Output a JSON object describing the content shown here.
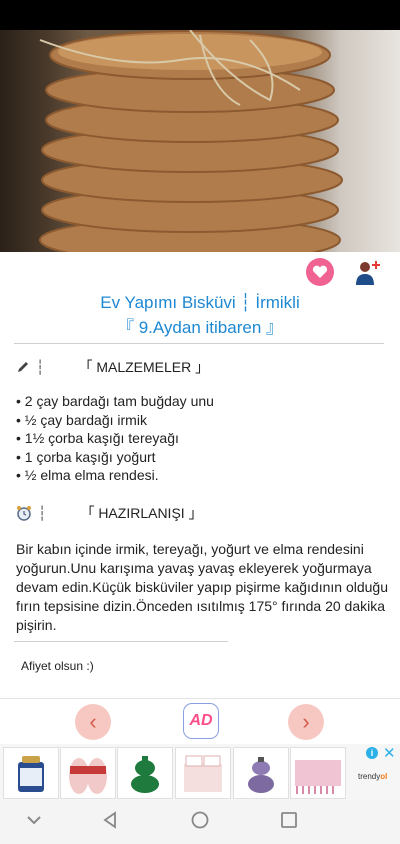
{
  "recipe": {
    "title_line1": "Ev Yapımı Bisküvi ┆ İrmikli",
    "title_line2": "『 9.Aydan itibaren 』"
  },
  "ingredients_section": {
    "icon": "pencil-icon",
    "separator": "┆",
    "label": "「 MALZEMELER 」",
    "items": [
      "• 2 çay bardağı tam buğday unu",
      "• ½ çay bardağı irmik",
      "• 1½ çorba kaşığı tereyağı",
      "• 1 çorba kaşığı yoğurt",
      "• ½ elma elma rendesi."
    ]
  },
  "preparation_section": {
    "icon": "alarm-clock-icon",
    "separator": "┆",
    "label": "「 HAZIRLANIŞI 」",
    "text": "Bir kabın içinde irmik, tereyağı, yoğurt ve elma rendesini yoğurun.Unu karışıma yavaş yavaş ekleyerek yoğurmaya devam edin.Küçük bisküviler yapıp pişirme kağıdının olduğu fırın tepsisine dizin.Önceden ısıtılmış 175° fırında 20 dakika pişirin."
  },
  "closing": "Afiyet olsun :)",
  "ad_toolbar": {
    "prev_glyph": "‹",
    "next_glyph": "›",
    "logo_text": "AD"
  },
  "ad_banner": {
    "brand_prefix": "trendy",
    "brand_suffix": "ol",
    "info_glyph": "i",
    "close_glyph": "✕"
  },
  "colors": {
    "title": "#1e88d3",
    "favorite": "#f06292",
    "arrow_bg": "#f7c8c2",
    "arrow_fg": "#d45a4d"
  }
}
